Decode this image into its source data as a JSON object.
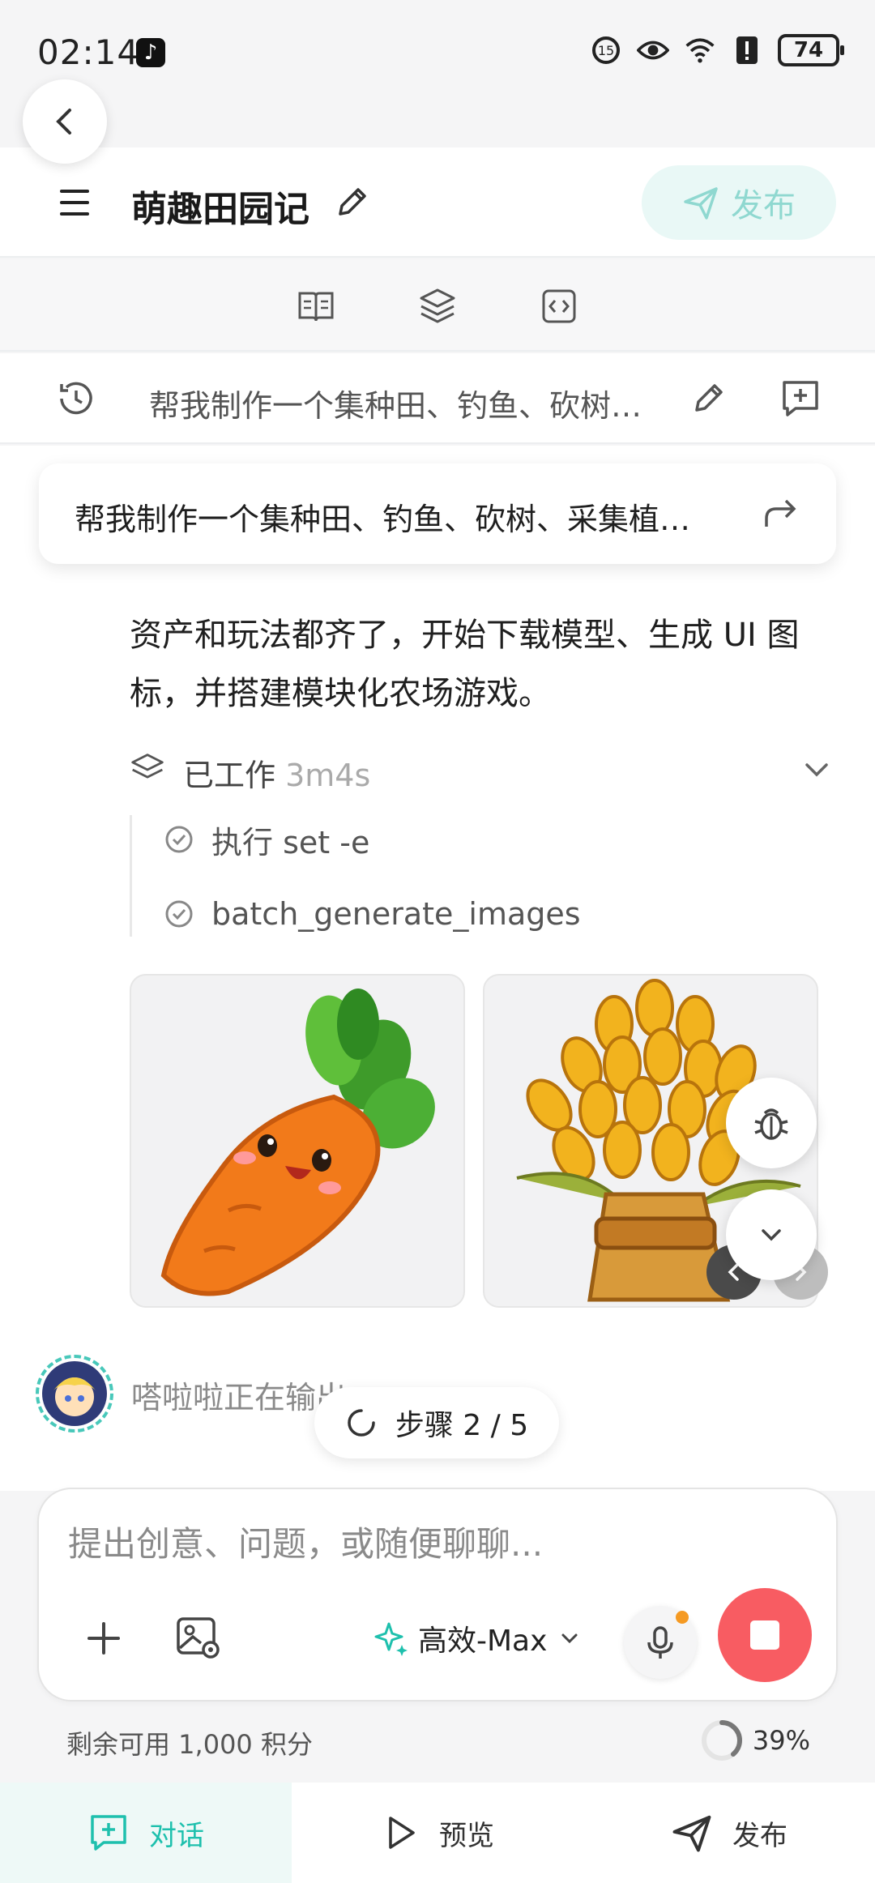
{
  "status_bar": {
    "time": "02:14",
    "battery": "74"
  },
  "app": {
    "title": "萌趣田园记",
    "publish_label": "发布"
  },
  "history": {
    "prompt_summary": "帮我制作一个集种田、钓鱼、砍树…"
  },
  "chat": {
    "pinned_prompt": "帮我制作一个集种田、钓鱼、砍树、采集植…",
    "assistant_message": "资产和玩法都齐了，开始下载模型、生成 UI 图标，并搭建模块化农场游戏。",
    "worked_label": "已工作",
    "worked_duration": "3m4s",
    "steps": [
      {
        "label": "执行 set -e"
      },
      {
        "label": "batch_generate_images"
      }
    ],
    "images": [
      {
        "icon": "carrot-icon"
      },
      {
        "icon": "wheat-icon"
      }
    ],
    "agent_status": "嗒啦啦正在输出…",
    "step_progress": "步骤 2 / 5"
  },
  "composer": {
    "placeholder": "提出创意、问题，或随便聊聊...",
    "model": "高效-Max"
  },
  "footer": {
    "credits": "剩余可用 1,000 积分",
    "progress_percent": "39%",
    "progress_value": 0.39
  },
  "nav": {
    "chat": "对话",
    "preview": "预览",
    "publish": "发布"
  },
  "colors": {
    "accent": "#1ec0ad",
    "stop": "#f85c62"
  }
}
